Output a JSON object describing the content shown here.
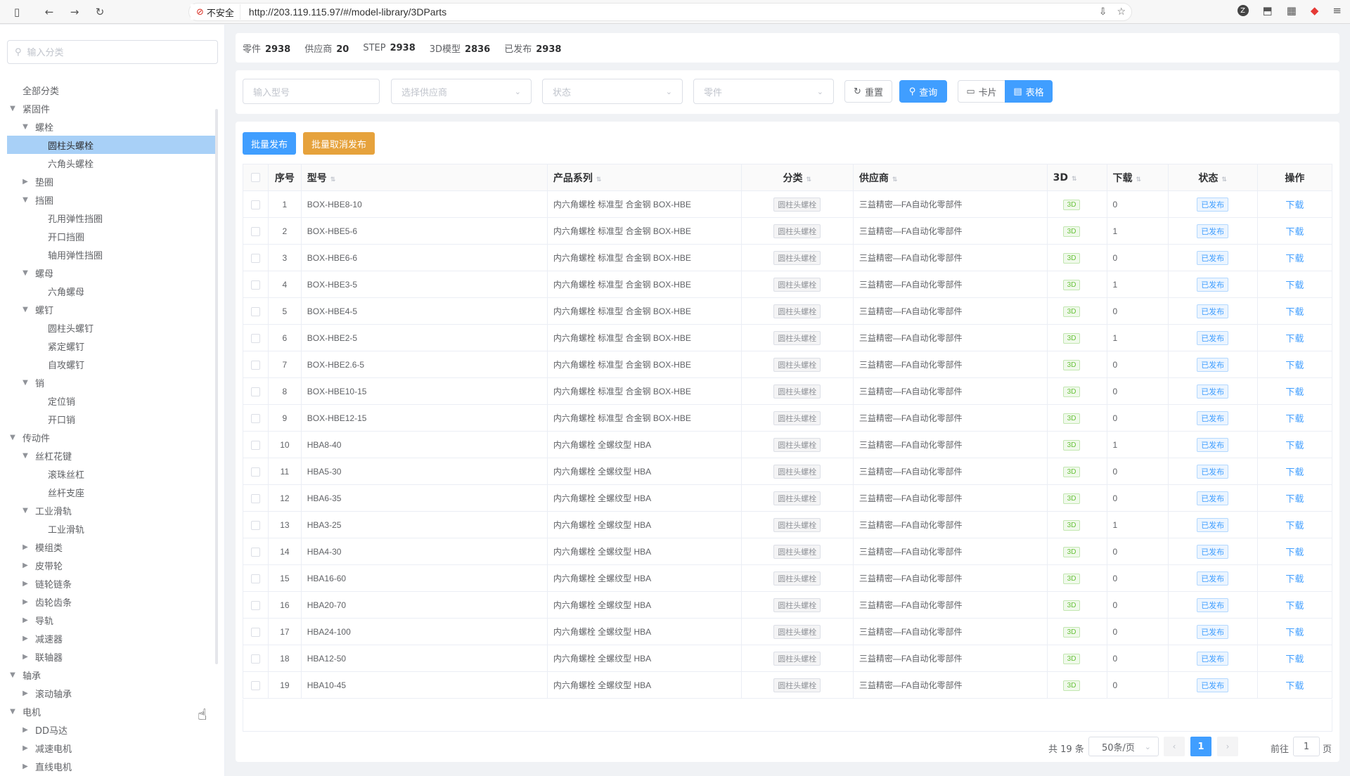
{
  "browser": {
    "insecure_label": "不安全",
    "url": "http://203.119.115.97/#/model-library/3DParts"
  },
  "sidebar": {
    "search_placeholder": "输入分类",
    "tree": [
      {
        "label": "全部分类",
        "level": 0,
        "arrow": "none"
      },
      {
        "label": "紧固件",
        "level": 0,
        "arrow": "open"
      },
      {
        "label": "螺栓",
        "level": 1,
        "arrow": "open"
      },
      {
        "label": "圆柱头螺栓",
        "level": 2,
        "arrow": "none",
        "active": true
      },
      {
        "label": "六角头螺栓",
        "level": 2,
        "arrow": "none"
      },
      {
        "label": "垫圈",
        "level": 1,
        "arrow": "closed"
      },
      {
        "label": "挡圈",
        "level": 1,
        "arrow": "open"
      },
      {
        "label": "孔用弹性挡圈",
        "level": 2,
        "arrow": "none"
      },
      {
        "label": "开口挡圈",
        "level": 2,
        "arrow": "none"
      },
      {
        "label": "轴用弹性挡圈",
        "level": 2,
        "arrow": "none"
      },
      {
        "label": "螺母",
        "level": 1,
        "arrow": "open"
      },
      {
        "label": "六角螺母",
        "level": 2,
        "arrow": "none"
      },
      {
        "label": "螺钉",
        "level": 1,
        "arrow": "open"
      },
      {
        "label": "圆柱头螺钉",
        "level": 2,
        "arrow": "none"
      },
      {
        "label": "紧定螺钉",
        "level": 2,
        "arrow": "none"
      },
      {
        "label": "自攻螺钉",
        "level": 2,
        "arrow": "none"
      },
      {
        "label": "销",
        "level": 1,
        "arrow": "open"
      },
      {
        "label": "定位销",
        "level": 2,
        "arrow": "none"
      },
      {
        "label": "开口销",
        "level": 2,
        "arrow": "none"
      },
      {
        "label": "传动件",
        "level": 0,
        "arrow": "open"
      },
      {
        "label": "丝杠花键",
        "level": 1,
        "arrow": "open"
      },
      {
        "label": "滚珠丝杠",
        "level": 2,
        "arrow": "none"
      },
      {
        "label": "丝杆支座",
        "level": 2,
        "arrow": "none"
      },
      {
        "label": "工业滑轨",
        "level": 1,
        "arrow": "open"
      },
      {
        "label": "工业滑轨",
        "level": 2,
        "arrow": "none"
      },
      {
        "label": "模组类",
        "level": 1,
        "arrow": "closed"
      },
      {
        "label": "皮带轮",
        "level": 1,
        "arrow": "closed"
      },
      {
        "label": "链轮链条",
        "level": 1,
        "arrow": "closed"
      },
      {
        "label": "齿轮齿条",
        "level": 1,
        "arrow": "closed"
      },
      {
        "label": "导轨",
        "level": 1,
        "arrow": "closed"
      },
      {
        "label": "减速器",
        "level": 1,
        "arrow": "closed"
      },
      {
        "label": "联轴器",
        "level": 1,
        "arrow": "closed"
      },
      {
        "label": "轴承",
        "level": 0,
        "arrow": "open"
      },
      {
        "label": "滚动轴承",
        "level": 1,
        "arrow": "closed"
      },
      {
        "label": "电机",
        "level": 0,
        "arrow": "open"
      },
      {
        "label": "DD马达",
        "level": 1,
        "arrow": "closed"
      },
      {
        "label": "减速电机",
        "level": 1,
        "arrow": "closed"
      },
      {
        "label": "直线电机",
        "level": 1,
        "arrow": "closed"
      }
    ]
  },
  "stats": [
    {
      "label": "零件",
      "value": "2938"
    },
    {
      "label": "供应商",
      "value": "20"
    },
    {
      "label": "STEP",
      "value": "2938"
    },
    {
      "label": "3D模型",
      "value": "2836"
    },
    {
      "label": "已发布",
      "value": "2938"
    }
  ],
  "filters": {
    "model_placeholder": "输入型号",
    "supplier_placeholder": "选择供应商",
    "status_placeholder": "状态",
    "part_placeholder": "零件",
    "reset_label": "重置",
    "query_label": "查询",
    "card_label": "卡片",
    "table_label": "表格"
  },
  "bulk": {
    "publish_label": "批量发布",
    "unpublish_label": "批量取消发布"
  },
  "table": {
    "headers": {
      "index": "序号",
      "model": "型号",
      "series": "产品系列",
      "category": "分类",
      "supplier": "供应商",
      "three_d": "3D",
      "downloads": "下载",
      "status": "状态",
      "actions": "操作"
    },
    "rows": [
      {
        "index": "1",
        "model": "BOX-HBE8-10",
        "series": "内六角螺栓 标准型 合金钢 BOX-HBE",
        "category": "圆柱头螺栓",
        "supplier": "三益精密—FA自动化零部件",
        "three_d": "3D",
        "downloads": "0",
        "status": "已发布",
        "action": "下载"
      },
      {
        "index": "2",
        "model": "BOX-HBE5-6",
        "series": "内六角螺栓 标准型 合金钢 BOX-HBE",
        "category": "圆柱头螺栓",
        "supplier": "三益精密—FA自动化零部件",
        "three_d": "3D",
        "downloads": "1",
        "status": "已发布",
        "action": "下载"
      },
      {
        "index": "3",
        "model": "BOX-HBE6-6",
        "series": "内六角螺栓 标准型 合金钢 BOX-HBE",
        "category": "圆柱头螺栓",
        "supplier": "三益精密—FA自动化零部件",
        "three_d": "3D",
        "downloads": "0",
        "status": "已发布",
        "action": "下载"
      },
      {
        "index": "4",
        "model": "BOX-HBE3-5",
        "series": "内六角螺栓 标准型 合金钢 BOX-HBE",
        "category": "圆柱头螺栓",
        "supplier": "三益精密—FA自动化零部件",
        "three_d": "3D",
        "downloads": "1",
        "status": "已发布",
        "action": "下载"
      },
      {
        "index": "5",
        "model": "BOX-HBE4-5",
        "series": "内六角螺栓 标准型 合金钢 BOX-HBE",
        "category": "圆柱头螺栓",
        "supplier": "三益精密—FA自动化零部件",
        "three_d": "3D",
        "downloads": "0",
        "status": "已发布",
        "action": "下载"
      },
      {
        "index": "6",
        "model": "BOX-HBE2-5",
        "series": "内六角螺栓 标准型 合金钢 BOX-HBE",
        "category": "圆柱头螺栓",
        "supplier": "三益精密—FA自动化零部件",
        "three_d": "3D",
        "downloads": "1",
        "status": "已发布",
        "action": "下载"
      },
      {
        "index": "7",
        "model": "BOX-HBE2.6-5",
        "series": "内六角螺栓 标准型 合金钢 BOX-HBE",
        "category": "圆柱头螺栓",
        "supplier": "三益精密—FA自动化零部件",
        "three_d": "3D",
        "downloads": "0",
        "status": "已发布",
        "action": "下载"
      },
      {
        "index": "8",
        "model": "BOX-HBE10-15",
        "series": "内六角螺栓 标准型 合金钢 BOX-HBE",
        "category": "圆柱头螺栓",
        "supplier": "三益精密—FA自动化零部件",
        "three_d": "3D",
        "downloads": "0",
        "status": "已发布",
        "action": "下载"
      },
      {
        "index": "9",
        "model": "BOX-HBE12-15",
        "series": "内六角螺栓 标准型 合金钢 BOX-HBE",
        "category": "圆柱头螺栓",
        "supplier": "三益精密—FA自动化零部件",
        "three_d": "3D",
        "downloads": "0",
        "status": "已发布",
        "action": "下载"
      },
      {
        "index": "10",
        "model": "HBA8-40",
        "series": "内六角螺栓 全螺纹型 HBA",
        "category": "圆柱头螺栓",
        "supplier": "三益精密—FA自动化零部件",
        "three_d": "3D",
        "downloads": "1",
        "status": "已发布",
        "action": "下载"
      },
      {
        "index": "11",
        "model": "HBA5-30",
        "series": "内六角螺栓 全螺纹型 HBA",
        "category": "圆柱头螺栓",
        "supplier": "三益精密—FA自动化零部件",
        "three_d": "3D",
        "downloads": "0",
        "status": "已发布",
        "action": "下载"
      },
      {
        "index": "12",
        "model": "HBA6-35",
        "series": "内六角螺栓 全螺纹型 HBA",
        "category": "圆柱头螺栓",
        "supplier": "三益精密—FA自动化零部件",
        "three_d": "3D",
        "downloads": "0",
        "status": "已发布",
        "action": "下载"
      },
      {
        "index": "13",
        "model": "HBA3-25",
        "series": "内六角螺栓 全螺纹型 HBA",
        "category": "圆柱头螺栓",
        "supplier": "三益精密—FA自动化零部件",
        "three_d": "3D",
        "downloads": "1",
        "status": "已发布",
        "action": "下载"
      },
      {
        "index": "14",
        "model": "HBA4-30",
        "series": "内六角螺栓 全螺纹型 HBA",
        "category": "圆柱头螺栓",
        "supplier": "三益精密—FA自动化零部件",
        "three_d": "3D",
        "downloads": "0",
        "status": "已发布",
        "action": "下载"
      },
      {
        "index": "15",
        "model": "HBA16-60",
        "series": "内六角螺栓 全螺纹型 HBA",
        "category": "圆柱头螺栓",
        "supplier": "三益精密—FA自动化零部件",
        "three_d": "3D",
        "downloads": "0",
        "status": "已发布",
        "action": "下载"
      },
      {
        "index": "16",
        "model": "HBA20-70",
        "series": "内六角螺栓 全螺纹型 HBA",
        "category": "圆柱头螺栓",
        "supplier": "三益精密—FA自动化零部件",
        "three_d": "3D",
        "downloads": "0",
        "status": "已发布",
        "action": "下载"
      },
      {
        "index": "17",
        "model": "HBA24-100",
        "series": "内六角螺栓 全螺纹型 HBA",
        "category": "圆柱头螺栓",
        "supplier": "三益精密—FA自动化零部件",
        "three_d": "3D",
        "downloads": "0",
        "status": "已发布",
        "action": "下载"
      },
      {
        "index": "18",
        "model": "HBA12-50",
        "series": "内六角螺栓 全螺纹型 HBA",
        "category": "圆柱头螺栓",
        "supplier": "三益精密—FA自动化零部件",
        "three_d": "3D",
        "downloads": "0",
        "status": "已发布",
        "action": "下载"
      },
      {
        "index": "19",
        "model": "HBA10-45",
        "series": "内六角螺栓 全螺纹型 HBA",
        "category": "圆柱头螺栓",
        "supplier": "三益精密—FA自动化零部件",
        "three_d": "3D",
        "downloads": "0",
        "status": "已发布",
        "action": "下载"
      }
    ]
  },
  "pagination": {
    "total_label": "共 19 条",
    "page_size_label": "50条/页",
    "current_page": "1",
    "goto_label": "前往",
    "goto_value": "1",
    "page_unit": "页"
  },
  "colors": {
    "primary": "#409eff",
    "warning": "#e6a23c",
    "success": "#67c23a",
    "active_tree_bg": "#a8d0f7"
  }
}
